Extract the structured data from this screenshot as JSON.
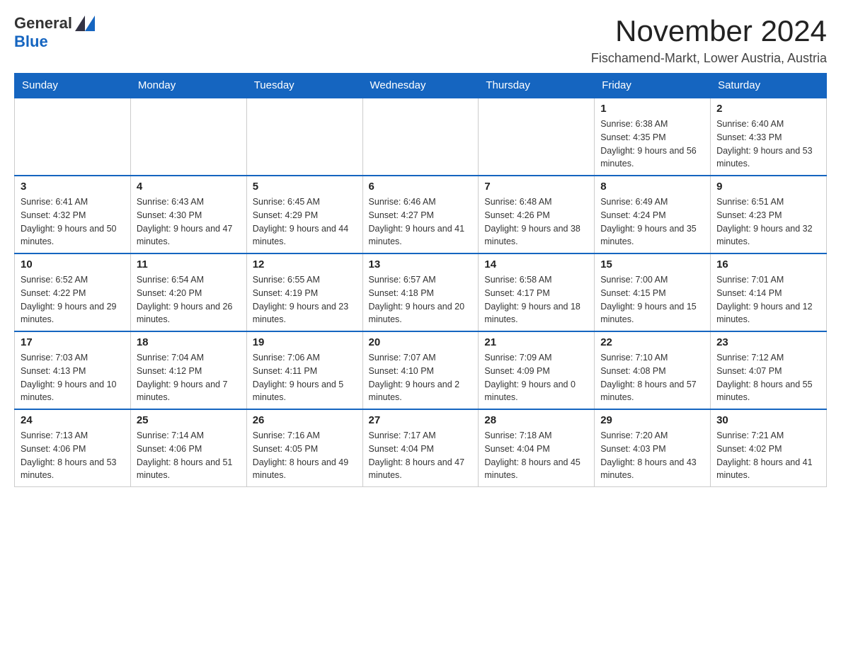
{
  "header": {
    "logo_general": "General",
    "logo_blue": "Blue",
    "month_title": "November 2024",
    "location": "Fischamend-Markt, Lower Austria, Austria"
  },
  "weekdays": [
    "Sunday",
    "Monday",
    "Tuesday",
    "Wednesday",
    "Thursday",
    "Friday",
    "Saturday"
  ],
  "weeks": [
    [
      {
        "day": "",
        "info": ""
      },
      {
        "day": "",
        "info": ""
      },
      {
        "day": "",
        "info": ""
      },
      {
        "day": "",
        "info": ""
      },
      {
        "day": "",
        "info": ""
      },
      {
        "day": "1",
        "info": "Sunrise: 6:38 AM\nSunset: 4:35 PM\nDaylight: 9 hours and 56 minutes."
      },
      {
        "day": "2",
        "info": "Sunrise: 6:40 AM\nSunset: 4:33 PM\nDaylight: 9 hours and 53 minutes."
      }
    ],
    [
      {
        "day": "3",
        "info": "Sunrise: 6:41 AM\nSunset: 4:32 PM\nDaylight: 9 hours and 50 minutes."
      },
      {
        "day": "4",
        "info": "Sunrise: 6:43 AM\nSunset: 4:30 PM\nDaylight: 9 hours and 47 minutes."
      },
      {
        "day": "5",
        "info": "Sunrise: 6:45 AM\nSunset: 4:29 PM\nDaylight: 9 hours and 44 minutes."
      },
      {
        "day": "6",
        "info": "Sunrise: 6:46 AM\nSunset: 4:27 PM\nDaylight: 9 hours and 41 minutes."
      },
      {
        "day": "7",
        "info": "Sunrise: 6:48 AM\nSunset: 4:26 PM\nDaylight: 9 hours and 38 minutes."
      },
      {
        "day": "8",
        "info": "Sunrise: 6:49 AM\nSunset: 4:24 PM\nDaylight: 9 hours and 35 minutes."
      },
      {
        "day": "9",
        "info": "Sunrise: 6:51 AM\nSunset: 4:23 PM\nDaylight: 9 hours and 32 minutes."
      }
    ],
    [
      {
        "day": "10",
        "info": "Sunrise: 6:52 AM\nSunset: 4:22 PM\nDaylight: 9 hours and 29 minutes."
      },
      {
        "day": "11",
        "info": "Sunrise: 6:54 AM\nSunset: 4:20 PM\nDaylight: 9 hours and 26 minutes."
      },
      {
        "day": "12",
        "info": "Sunrise: 6:55 AM\nSunset: 4:19 PM\nDaylight: 9 hours and 23 minutes."
      },
      {
        "day": "13",
        "info": "Sunrise: 6:57 AM\nSunset: 4:18 PM\nDaylight: 9 hours and 20 minutes."
      },
      {
        "day": "14",
        "info": "Sunrise: 6:58 AM\nSunset: 4:17 PM\nDaylight: 9 hours and 18 minutes."
      },
      {
        "day": "15",
        "info": "Sunrise: 7:00 AM\nSunset: 4:15 PM\nDaylight: 9 hours and 15 minutes."
      },
      {
        "day": "16",
        "info": "Sunrise: 7:01 AM\nSunset: 4:14 PM\nDaylight: 9 hours and 12 minutes."
      }
    ],
    [
      {
        "day": "17",
        "info": "Sunrise: 7:03 AM\nSunset: 4:13 PM\nDaylight: 9 hours and 10 minutes."
      },
      {
        "day": "18",
        "info": "Sunrise: 7:04 AM\nSunset: 4:12 PM\nDaylight: 9 hours and 7 minutes."
      },
      {
        "day": "19",
        "info": "Sunrise: 7:06 AM\nSunset: 4:11 PM\nDaylight: 9 hours and 5 minutes."
      },
      {
        "day": "20",
        "info": "Sunrise: 7:07 AM\nSunset: 4:10 PM\nDaylight: 9 hours and 2 minutes."
      },
      {
        "day": "21",
        "info": "Sunrise: 7:09 AM\nSunset: 4:09 PM\nDaylight: 9 hours and 0 minutes."
      },
      {
        "day": "22",
        "info": "Sunrise: 7:10 AM\nSunset: 4:08 PM\nDaylight: 8 hours and 57 minutes."
      },
      {
        "day": "23",
        "info": "Sunrise: 7:12 AM\nSunset: 4:07 PM\nDaylight: 8 hours and 55 minutes."
      }
    ],
    [
      {
        "day": "24",
        "info": "Sunrise: 7:13 AM\nSunset: 4:06 PM\nDaylight: 8 hours and 53 minutes."
      },
      {
        "day": "25",
        "info": "Sunrise: 7:14 AM\nSunset: 4:06 PM\nDaylight: 8 hours and 51 minutes."
      },
      {
        "day": "26",
        "info": "Sunrise: 7:16 AM\nSunset: 4:05 PM\nDaylight: 8 hours and 49 minutes."
      },
      {
        "day": "27",
        "info": "Sunrise: 7:17 AM\nSunset: 4:04 PM\nDaylight: 8 hours and 47 minutes."
      },
      {
        "day": "28",
        "info": "Sunrise: 7:18 AM\nSunset: 4:04 PM\nDaylight: 8 hours and 45 minutes."
      },
      {
        "day": "29",
        "info": "Sunrise: 7:20 AM\nSunset: 4:03 PM\nDaylight: 8 hours and 43 minutes."
      },
      {
        "day": "30",
        "info": "Sunrise: 7:21 AM\nSunset: 4:02 PM\nDaylight: 8 hours and 41 minutes."
      }
    ]
  ]
}
